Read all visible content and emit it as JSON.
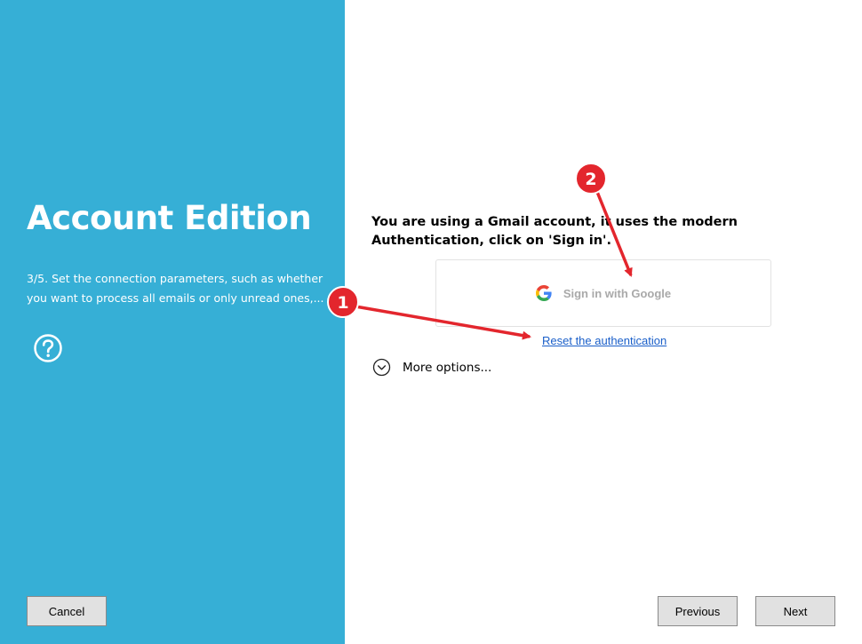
{
  "sidebar": {
    "title": "Account Edition",
    "step_description": "3/5. Set the connection parameters, such as whether you want to process all emails or only unread ones,...",
    "help_icon": "question-circle-icon",
    "background_color": "#36afd6"
  },
  "main": {
    "info_text": "You are using a Gmail account, it uses the modern Authentication, click on 'Sign in'.",
    "google_button": {
      "label": "Sign in with Google",
      "icon": "google-logo-icon"
    },
    "reset_link": "Reset the authentication",
    "more_options": {
      "label": "More options...",
      "icon": "chevron-down-circle-icon"
    }
  },
  "footer": {
    "cancel_label": "Cancel",
    "previous_label": "Previous",
    "next_label": "Next"
  },
  "annotations": {
    "badge_1": "1",
    "badge_2": "2",
    "color": "#e3262d"
  },
  "colors": {
    "link": "#1a5fc9",
    "button_bg": "#e1e1e1"
  }
}
